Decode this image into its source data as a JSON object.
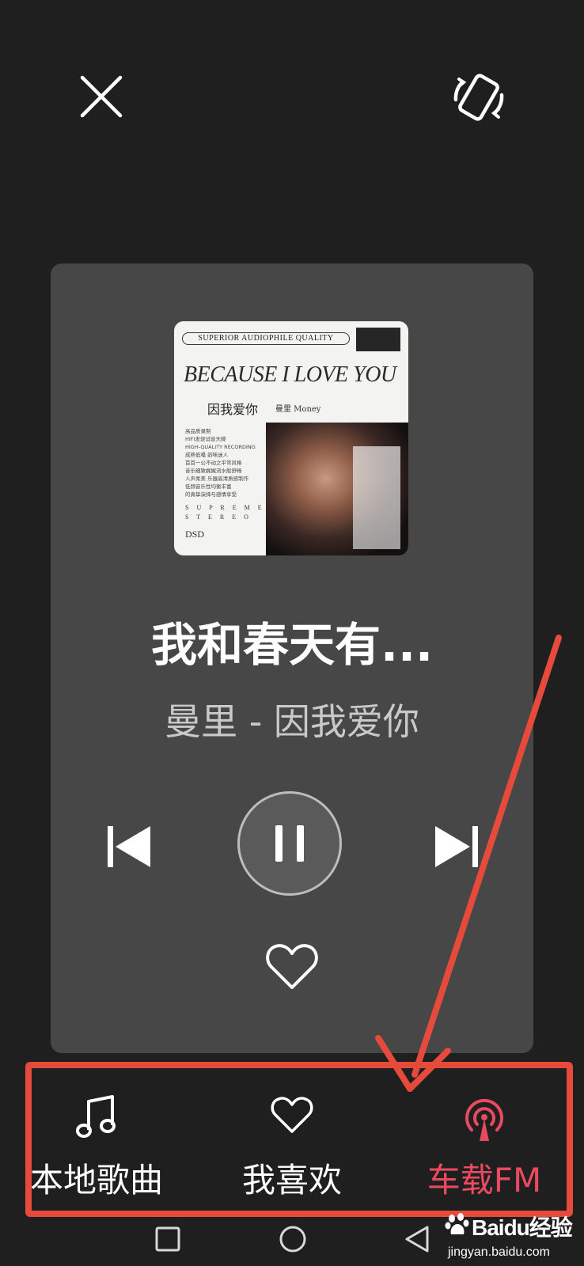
{
  "colors": {
    "background": "#1f1f1f",
    "card": "#474747",
    "active": "#e84a5f",
    "annotation": "#e64a3b"
  },
  "header": {
    "close_icon": "close-icon",
    "rotate_icon": "screen-rotate-icon"
  },
  "album": {
    "band_text": "SUPERIOR AUDIOPHILE QUALITY",
    "title_en": "BECAUSE I LOVE YOU",
    "title_cn": "因我爱你",
    "subtitle": "曼里 Money",
    "blurb": [
      "高品质录制",
      "HIFI发烧试音天碟",
      "HIGH-QUALITY RECORDING",
      "成熟低嗓 韵味迷人",
      "首首一公不动之平常风格",
      "音乐细致娓娓流水般舒畅",
      "人声柔美 乐器高清质感制作",
      "低频音乐性均衡丰富",
      "的真挚演绎与感情享受"
    ],
    "supreme": "S U P R E M E",
    "stereo": "S T E R E O",
    "dsd": "DSD"
  },
  "player": {
    "song_title": "我和春天有...",
    "song_subtitle": "曼里 - 因我爱你",
    "prev_icon": "skip-previous-icon",
    "pause_icon": "pause-icon",
    "next_icon": "skip-next-icon",
    "like_icon": "heart-outline-icon"
  },
  "bottom_nav": {
    "items": [
      {
        "label": "本地歌曲",
        "icon": "music-note-icon",
        "active": false
      },
      {
        "label": "我喜欢",
        "icon": "heart-outline-icon",
        "active": false
      },
      {
        "label": "车载FM",
        "icon": "radio-broadcast-icon",
        "active": true
      }
    ]
  },
  "system_nav": {
    "recents_icon": "square-icon",
    "home_icon": "circle-icon",
    "back_icon": "triangle-back-icon"
  },
  "watermark": {
    "brand": "Baidu经验",
    "url": "jingyan.baidu.com"
  }
}
